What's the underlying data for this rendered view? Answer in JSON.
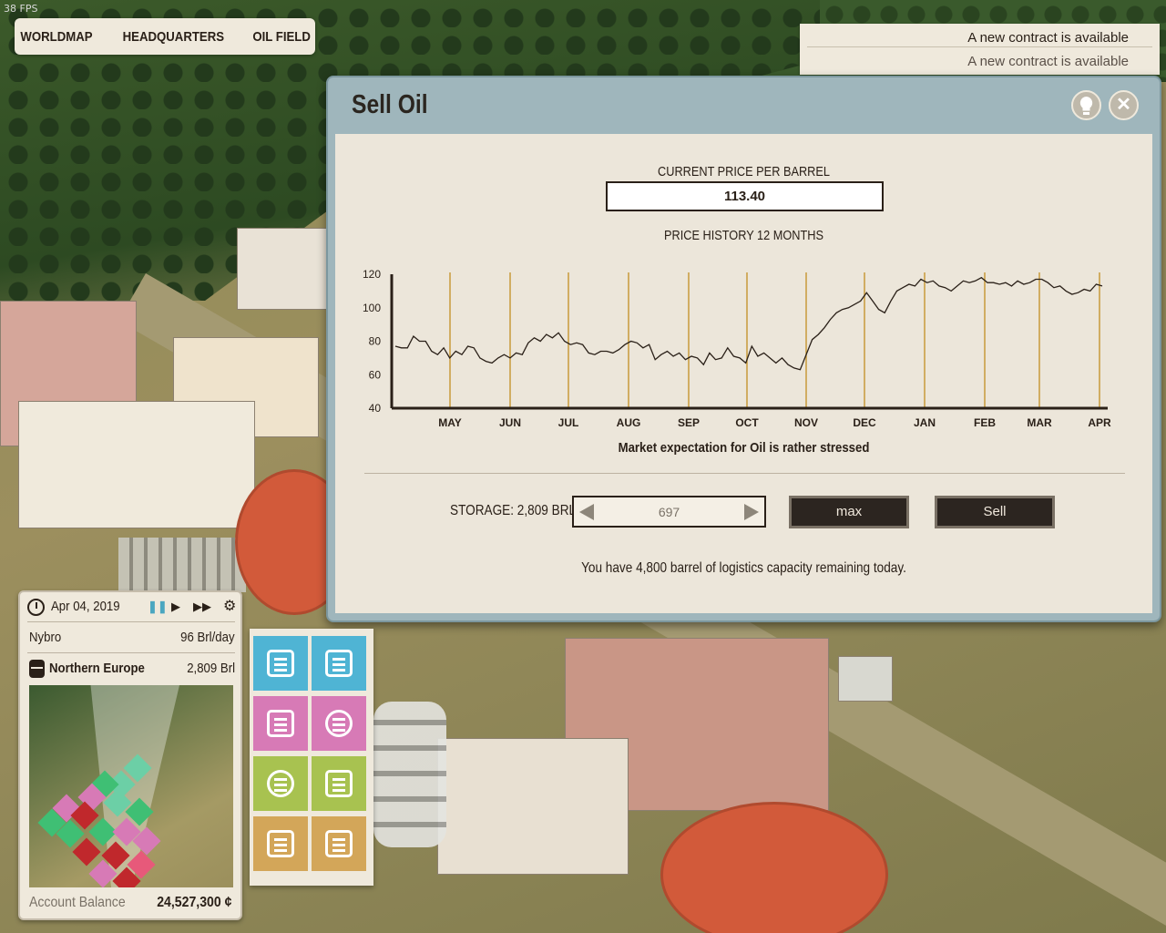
{
  "fps": "38 FPS",
  "topnav": {
    "items": [
      "WORLDMAP",
      "HEADQUARTERS",
      "OIL FIELD"
    ]
  },
  "notifications": [
    "A new contract is available",
    "A new contract is available"
  ],
  "dialog": {
    "title": "Sell Oil",
    "help_icon": "lightbulb-icon",
    "close_icon": "close-icon",
    "current_price_label": "CURRENT PRICE PER BARREL",
    "current_price": "113.40",
    "history_label": "PRICE HISTORY 12 MONTHS",
    "market_expectation": "Market expectation for Oil is rather stressed",
    "storage_label": "STORAGE: 2,809 BRL",
    "quantity": "697",
    "max_label": "max",
    "sell_label": "Sell",
    "capacity_text": "You have 4,800 barrel of logistics capacity remaining today."
  },
  "chart_data": {
    "type": "line",
    "categories": [
      "MAY",
      "JUN",
      "JUL",
      "AUG",
      "SEP",
      "OCT",
      "NOV",
      "DEC",
      "JAN",
      "FEB",
      "MAR",
      "APR"
    ],
    "ylim": [
      40,
      120
    ],
    "yticks": [
      120,
      100,
      80,
      60,
      40
    ],
    "grid": "vertical month lines",
    "line_color": "#2a2018",
    "gridline_color": "#c89a3a",
    "series": [
      {
        "values": [
          77,
          76,
          76,
          83,
          80,
          80,
          74,
          72,
          76,
          70,
          74,
          72,
          77,
          76,
          70,
          68,
          67,
          70,
          72,
          70,
          73,
          72,
          79,
          82,
          80,
          84,
          82,
          85,
          80,
          78,
          79,
          78,
          73,
          72,
          74,
          74,
          73,
          75,
          78,
          80,
          79,
          76,
          78,
          69,
          72,
          74,
          71,
          73,
          69,
          71,
          70,
          66,
          73,
          69,
          70,
          76,
          71,
          70,
          67,
          77,
          71,
          73,
          70,
          67,
          70,
          66,
          64,
          63,
          72,
          81,
          84,
          88,
          93,
          97,
          99,
          100,
          102,
          104,
          109,
          104,
          99,
          97,
          104,
          110,
          112,
          114,
          113,
          117,
          115,
          116,
          113,
          112,
          110,
          113,
          116,
          115,
          116,
          118,
          115,
          115,
          114,
          115,
          113,
          116,
          114,
          115,
          117,
          117,
          115,
          112,
          113,
          110,
          108,
          109,
          111,
          110,
          114,
          113
        ]
      }
    ]
  },
  "info_panel": {
    "date": "Apr 04, 2019",
    "clock_icon": "clock-icon",
    "controls": [
      "pause-icon",
      "play-icon",
      "fast-forward-icon",
      "gear-icon"
    ],
    "location_name": "Nybro",
    "location_rate": "96 Brl/day",
    "region_name": "Northern Europe",
    "region_storage": "2,809 Brl",
    "balance_label": "Account Balance",
    "balance_value": "24,527,300 ¢"
  },
  "action_grid": [
    {
      "name": "contracts-button",
      "icon": "document-list-icon",
      "color": "#4fb4d4"
    },
    {
      "name": "construction-button",
      "icon": "wheelbarrow-icon",
      "color": "#4fb4d4"
    },
    {
      "name": "finance-button",
      "icon": "calculator-icon",
      "color": "#d77ab6"
    },
    {
      "name": "logistics-button",
      "icon": "delivery-truck-icon",
      "color": "#d77ab6"
    },
    {
      "name": "research-button",
      "icon": "brain-icon",
      "color": "#a8c250"
    },
    {
      "name": "pipeline-button",
      "icon": "pipe-icon",
      "color": "#a8c250"
    },
    {
      "name": "notes-button",
      "icon": "notebook-icon",
      "color": "#d3a659"
    },
    {
      "name": "archive-button",
      "icon": "binders-icon",
      "color": "#d3a659"
    }
  ]
}
